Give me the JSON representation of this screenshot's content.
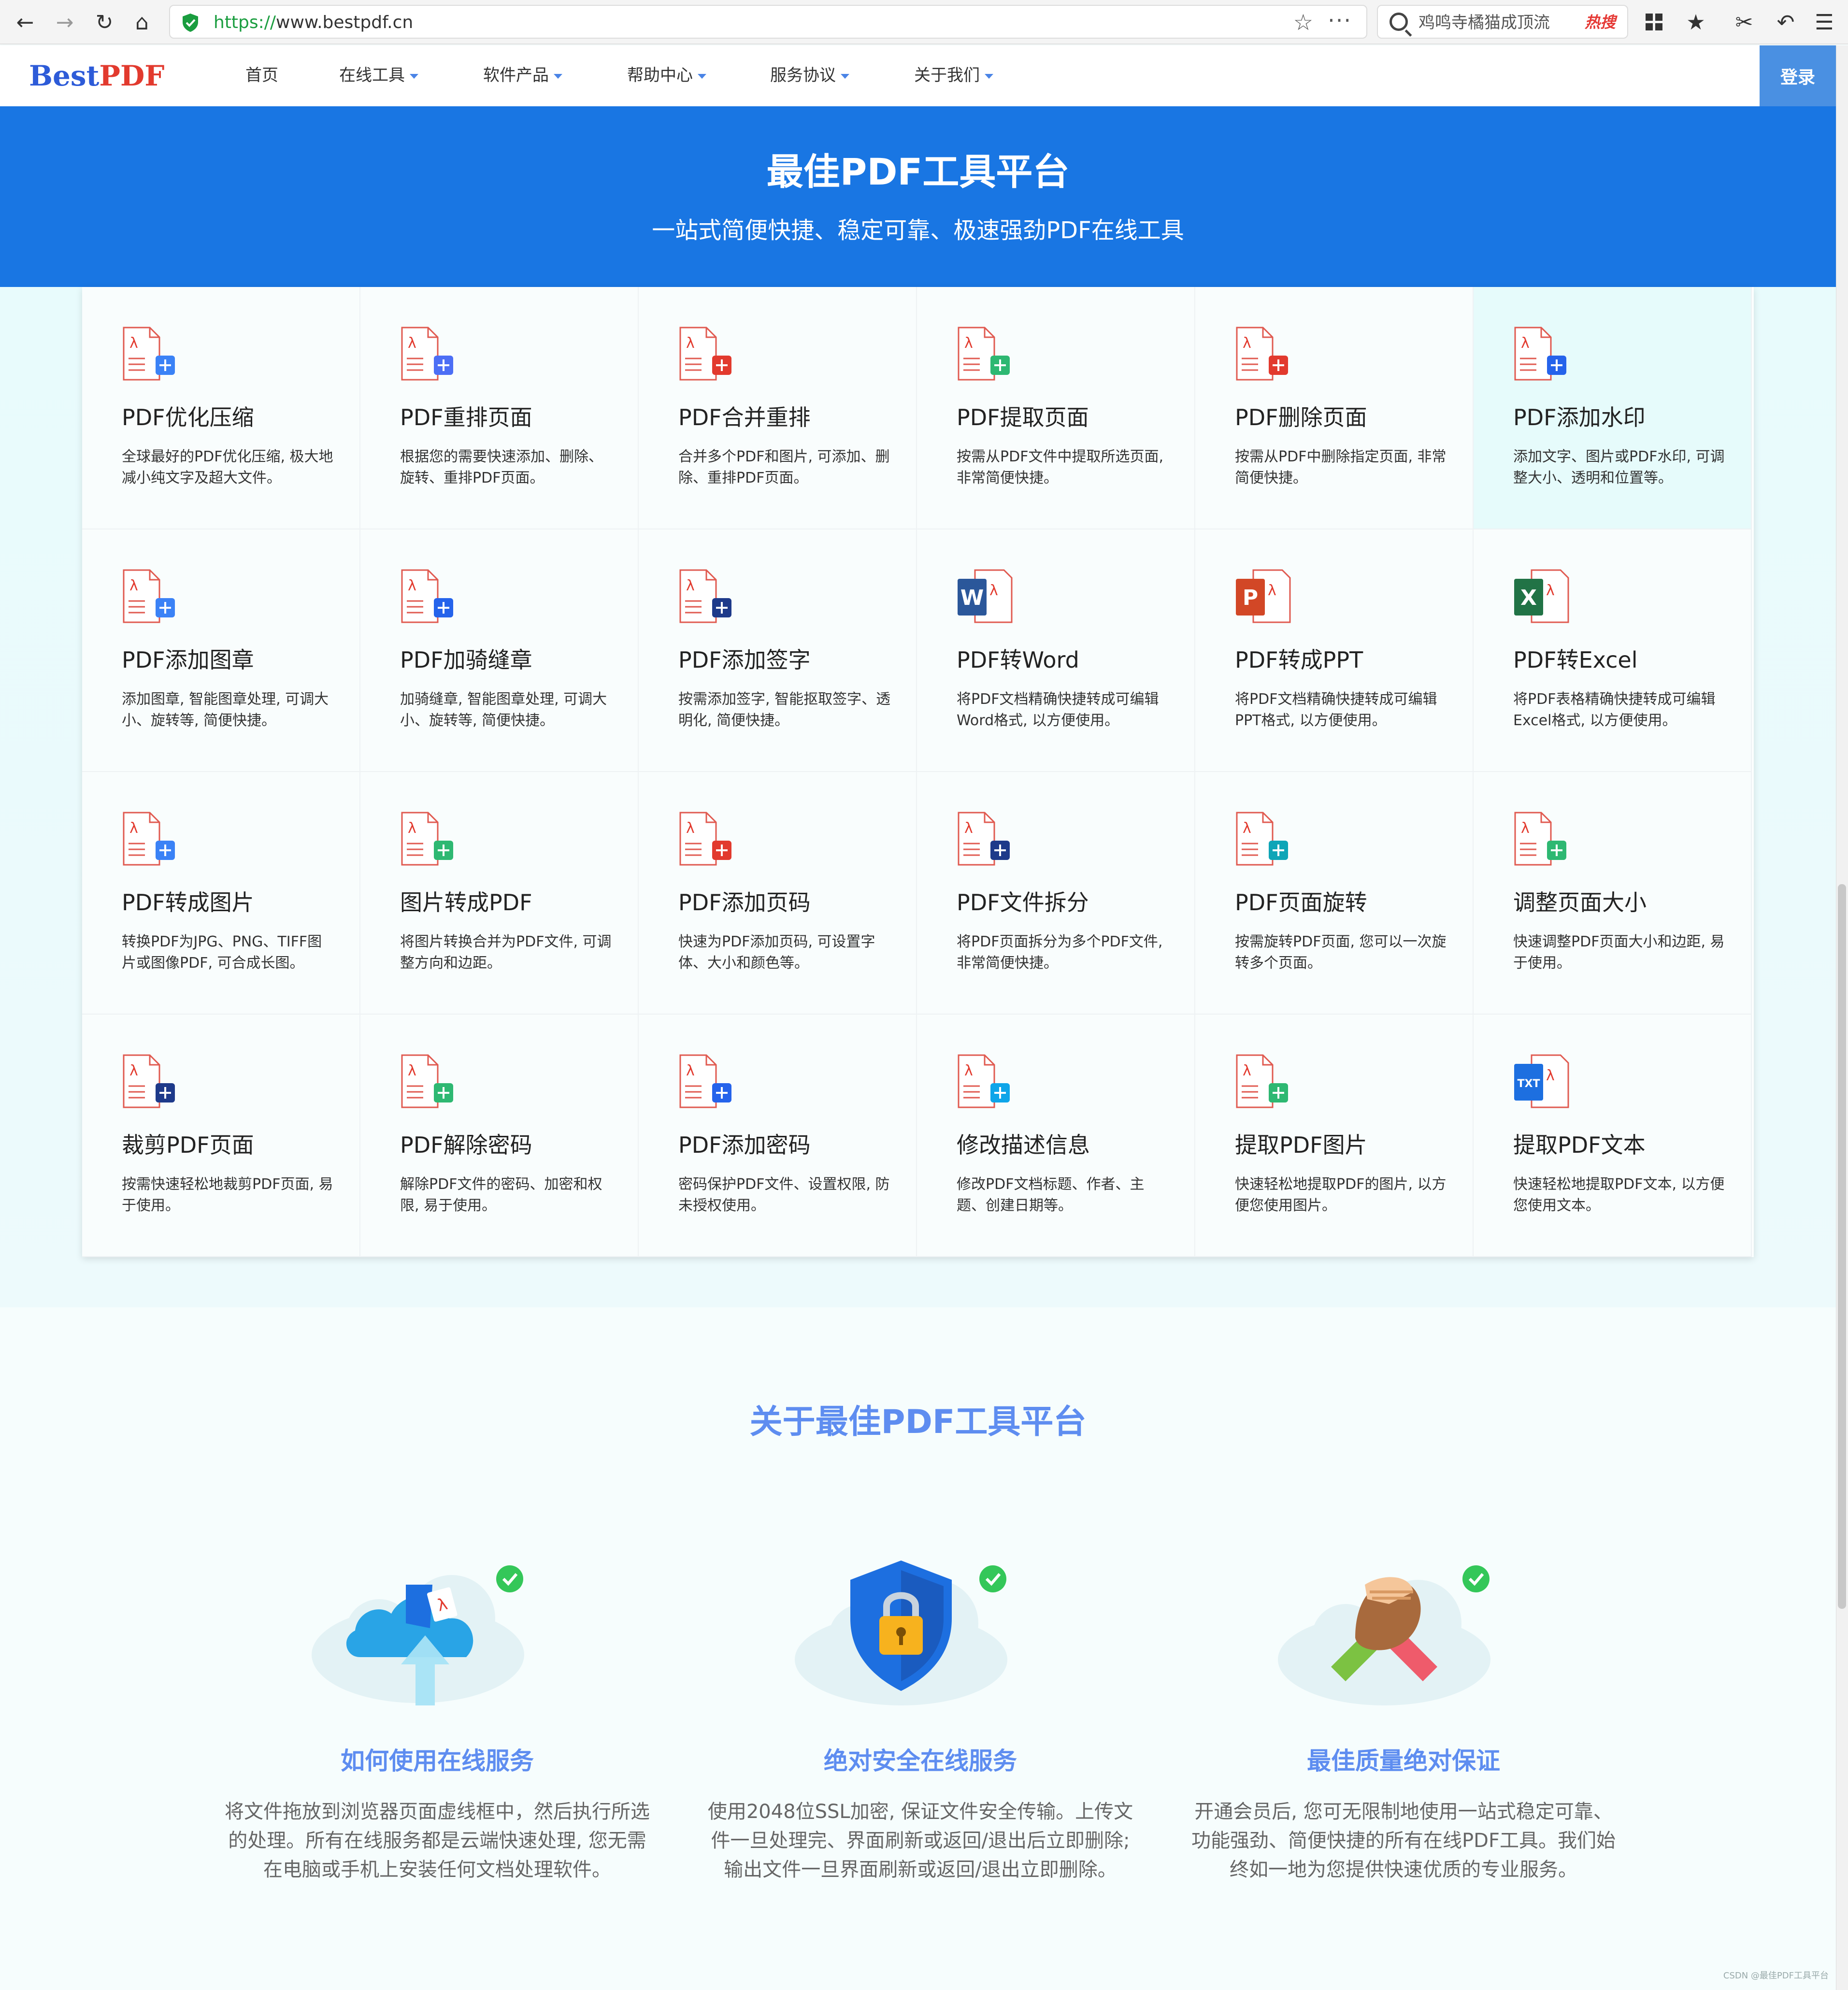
{
  "browser": {
    "url_protocol": "https://",
    "url_host": "www.bestpdf.cn",
    "search_text": "鸡鸣寺橘猫成顶流",
    "search_badge": "热搜"
  },
  "site": {
    "logo_part1": "Best",
    "logo_part2": "PDF",
    "nav": [
      {
        "label": "首页"
      },
      {
        "label": "在线工具"
      },
      {
        "label": "软件产品"
      },
      {
        "label": "帮助中心"
      },
      {
        "label": "服务协议"
      },
      {
        "label": "关于我们"
      }
    ],
    "login": "登录"
  },
  "hero": {
    "title": "最佳PDF工具平台",
    "subtitle": "一站式简便快捷、稳定可靠、极速强劲PDF在线工具"
  },
  "tools": [
    {
      "title": "PDF优化压缩",
      "desc": "全球最好的PDF优化压缩, 极大地减小纯文字及超大文件。",
      "icon": "compress-icon",
      "accent": "#3b82f6"
    },
    {
      "title": "PDF重排页面",
      "desc": "根据您的需要快速添加、删除、旋转、重排PDF页面。",
      "icon": "reorder-pages-icon",
      "accent": "#4c6ef5"
    },
    {
      "title": "PDF合并重排",
      "desc": "合并多个PDF和图片, 可添加、删除、重排PDF页面。",
      "icon": "merge-icon",
      "accent": "#e23a2e"
    },
    {
      "title": "PDF提取页面",
      "desc": "按需从PDF文件中提取所选页面, 非常简便快捷。",
      "icon": "extract-page-icon",
      "accent": "#2eb872"
    },
    {
      "title": "PDF删除页面",
      "desc": "按需从PDF中删除指定页面, 非常简便快捷。",
      "icon": "delete-page-icon",
      "accent": "#e23a2e"
    },
    {
      "title": "PDF添加水印",
      "desc": "添加文字、图片或PDF水印, 可调整大小、透明和位置等。",
      "icon": "watermark-icon",
      "accent": "#2563eb"
    },
    {
      "title": "PDF添加图章",
      "desc": "添加图章, 智能图章处理, 可调大小、旋转等, 简便快捷。",
      "icon": "stamp-icon",
      "accent": "#3b82f6"
    },
    {
      "title": "PDF加骑缝章",
      "desc": "加骑缝章, 智能图章处理, 可调大小、旋转等, 简便快捷。",
      "icon": "seam-stamp-icon",
      "accent": "#2563eb"
    },
    {
      "title": "PDF添加签字",
      "desc": "按需添加签字, 智能抠取签字、透明化, 简便快捷。",
      "icon": "signature-icon",
      "accent": "#1e3a8a"
    },
    {
      "title": "PDF转Word",
      "desc": "将PDF文档精确快捷转成可编辑Word格式, 以方便使用。",
      "icon": "word-icon",
      "accent": "#2b579a"
    },
    {
      "title": "PDF转成PPT",
      "desc": "将PDF文档精确快捷转成可编辑PPT格式, 以方便使用。",
      "icon": "ppt-icon",
      "accent": "#d24726"
    },
    {
      "title": "PDF转Excel",
      "desc": "将PDF表格精确快捷转成可编辑Excel格式, 以方便使用。",
      "icon": "excel-icon",
      "accent": "#217346"
    },
    {
      "title": "PDF转成图片",
      "desc": "转换PDF为JPG、PNG、TIFF图片或图像PDF, 可合成长图。",
      "icon": "pdf-to-image-icon",
      "accent": "#3b82f6"
    },
    {
      "title": "图片转成PDF",
      "desc": "将图片转换合并为PDF文件, 可调整方向和边距。",
      "icon": "image-to-pdf-icon",
      "accent": "#2eb872"
    },
    {
      "title": "PDF添加页码",
      "desc": "快速为PDF添加页码, 可设置字体、大小和颜色等。",
      "icon": "page-number-icon",
      "accent": "#e23a2e"
    },
    {
      "title": "PDF文件拆分",
      "desc": "将PDF页面拆分为多个PDF文件, 非常简便快捷。",
      "icon": "split-icon",
      "accent": "#1e3a8a"
    },
    {
      "title": "PDF页面旋转",
      "desc": "按需旋转PDF页面, 您可以一次旋转多个页面。",
      "icon": "rotate-icon",
      "accent": "#0ea5b7"
    },
    {
      "title": "调整页面大小",
      "desc": "快速调整PDF页面大小和边距, 易于使用。",
      "icon": "resize-icon",
      "accent": "#2eb872"
    },
    {
      "title": "裁剪PDF页面",
      "desc": "按需快速轻松地裁剪PDF页面, 易于使用。",
      "icon": "crop-icon",
      "accent": "#1e3a8a"
    },
    {
      "title": "PDF解除密码",
      "desc": "解除PDF文件的密码、加密和权限, 易于使用。",
      "icon": "unlock-icon",
      "accent": "#2eb872"
    },
    {
      "title": "PDF添加密码",
      "desc": "密码保护PDF文件、设置权限, 防未授权使用。",
      "icon": "lock-icon",
      "accent": "#2563eb"
    },
    {
      "title": "修改描述信息",
      "desc": "修改PDF文档标题、作者、主题、创建日期等。",
      "icon": "edit-info-icon",
      "accent": "#0ea5e9"
    },
    {
      "title": "提取PDF图片",
      "desc": "快速轻松地提取PDF的图片, 以方便您使用图片。",
      "icon": "extract-image-icon",
      "accent": "#2eb872"
    },
    {
      "title": "提取PDF文本",
      "desc": "快速轻松地提取PDF文本, 以方便您使用文本。",
      "icon": "txt-icon",
      "accent": "#1d6fe0"
    }
  ],
  "about": {
    "title": "关于最佳PDF工具平台",
    "features": [
      {
        "title": "如何使用在线服务",
        "desc": "将文件拖放到浏览器页面虚线框中，然后执行所选的处理。所有在线服务都是云端快速处理, 您无需在电脑或手机上安装任何文档处理软件。",
        "icon": "cloud-upload-icon"
      },
      {
        "title": "绝对安全在线服务",
        "desc": "使用2048位SSL加密, 保证文件安全传输。上传文件一旦处理完、界面刷新或返回/退出后立即删除; 输出文件一旦界面刷新或返回/退出立即删除。",
        "icon": "security-shield-icon"
      },
      {
        "title": "最佳质量绝对保证",
        "desc": "开通会员后, 您可无限制地使用一站式稳定可靠、功能强劲、简便快捷的所有在线PDF工具。我们始终如一地为您提供快速优质的专业服务。",
        "icon": "handshake-icon"
      }
    ]
  },
  "watermark": "CSDN @最佳PDF工具平台"
}
